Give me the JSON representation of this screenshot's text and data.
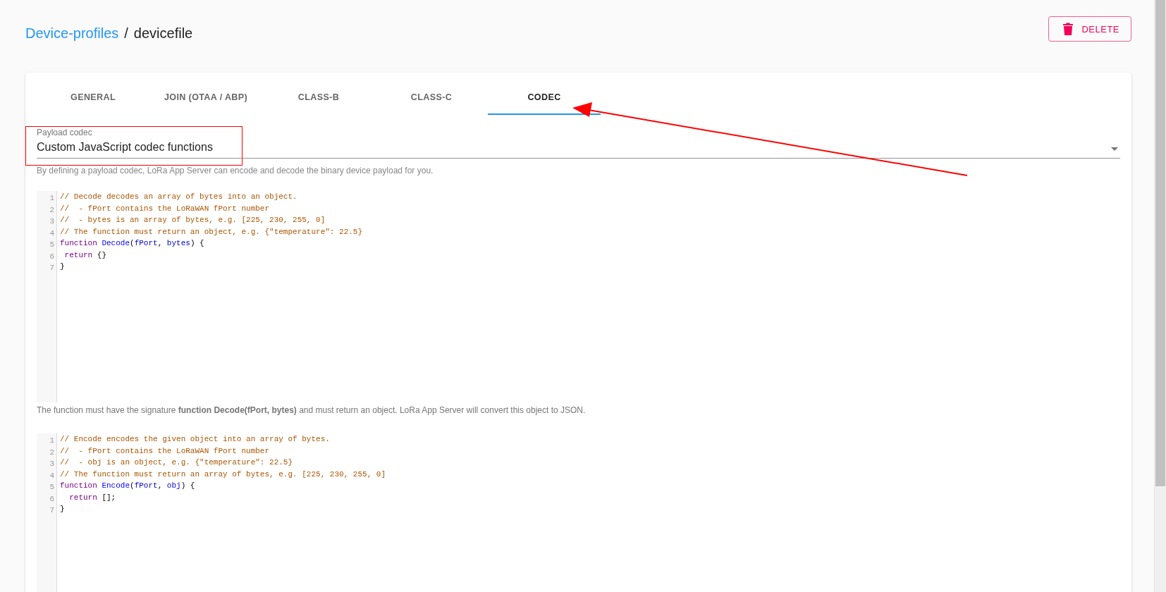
{
  "breadcrumb": {
    "parent": "Device-profiles",
    "separator": "/",
    "current": "devicefile"
  },
  "delete_button": {
    "label": "DELETE"
  },
  "tabs": [
    {
      "label": "GENERAL",
      "selected": false
    },
    {
      "label": "JOIN (OTAA / ABP)",
      "selected": false
    },
    {
      "label": "CLASS-B",
      "selected": false
    },
    {
      "label": "CLASS-C",
      "selected": false
    },
    {
      "label": "CODEC",
      "selected": true
    }
  ],
  "payload_codec": {
    "label": "Payload codec",
    "value": "Custom JavaScript codec functions",
    "helper": "By defining a payload codec, LoRa App Server can encode and decode the binary device payload for you."
  },
  "decode_editor": {
    "lines": [
      {
        "number": "1",
        "tokens": [
          {
            "kind": "comment",
            "text": "// Decode decodes an array of bytes into an object."
          }
        ]
      },
      {
        "number": "2",
        "tokens": [
          {
            "kind": "comment",
            "text": "//  - fPort contains the LoRaWAN fPort number"
          }
        ]
      },
      {
        "number": "3",
        "tokens": [
          {
            "kind": "comment",
            "text": "//  - bytes is an array of bytes, e.g. [225, 230, 255, 0]"
          }
        ]
      },
      {
        "number": "4",
        "tokens": [
          {
            "kind": "comment",
            "text": "// The function must return an object, e.g. {\"temperature\": 22.5}"
          }
        ]
      },
      {
        "number": "5",
        "tokens": [
          {
            "kind": "keyword",
            "text": "function "
          },
          {
            "kind": "def",
            "text": "Decode"
          },
          {
            "kind": "plain",
            "text": "("
          },
          {
            "kind": "variable",
            "text": "fPort"
          },
          {
            "kind": "plain",
            "text": ", "
          },
          {
            "kind": "variable",
            "text": "bytes"
          },
          {
            "kind": "plain",
            "text": ") {"
          }
        ]
      },
      {
        "number": "6",
        "tokens": [
          {
            "kind": "keyword",
            "text": " return "
          },
          {
            "kind": "plain",
            "text": "{}"
          }
        ]
      },
      {
        "number": "7",
        "tokens": [
          {
            "kind": "plain",
            "text": "}"
          }
        ]
      }
    ]
  },
  "decode_note": "The function must have the signature **function Decode(fPort, bytes)** and must return an object. LoRa App Server will convert this object to JSON.",
  "encode_editor": {
    "lines": [
      {
        "number": "1",
        "tokens": [
          {
            "kind": "comment",
            "text": "// Encode encodes the given object into an array of bytes."
          }
        ]
      },
      {
        "number": "2",
        "tokens": [
          {
            "kind": "comment",
            "text": "//  - fPort contains the LoRaWAN fPort number"
          }
        ]
      },
      {
        "number": "3",
        "tokens": [
          {
            "kind": "comment",
            "text": "//  - obj is an object, e.g. {\"temperature\": 22.5}"
          }
        ]
      },
      {
        "number": "4",
        "tokens": [
          {
            "kind": "comment",
            "text": "// The function must return an array of bytes, e.g. [225, 230, 255, 0]"
          }
        ]
      },
      {
        "number": "5",
        "tokens": [
          {
            "kind": "keyword",
            "text": "function "
          },
          {
            "kind": "def",
            "text": "Encode"
          },
          {
            "kind": "plain",
            "text": "("
          },
          {
            "kind": "variable",
            "text": "fPort"
          },
          {
            "kind": "plain",
            "text": ", "
          },
          {
            "kind": "variable",
            "text": "obj"
          },
          {
            "kind": "plain",
            "text": ") {"
          }
        ]
      },
      {
        "number": "6",
        "tokens": [
          {
            "kind": "keyword",
            "text": "  return "
          },
          {
            "kind": "plain",
            "text": "[];"
          }
        ]
      },
      {
        "number": "7",
        "tokens": [
          {
            "kind": "plain",
            "text": "}"
          }
        ]
      }
    ]
  }
}
